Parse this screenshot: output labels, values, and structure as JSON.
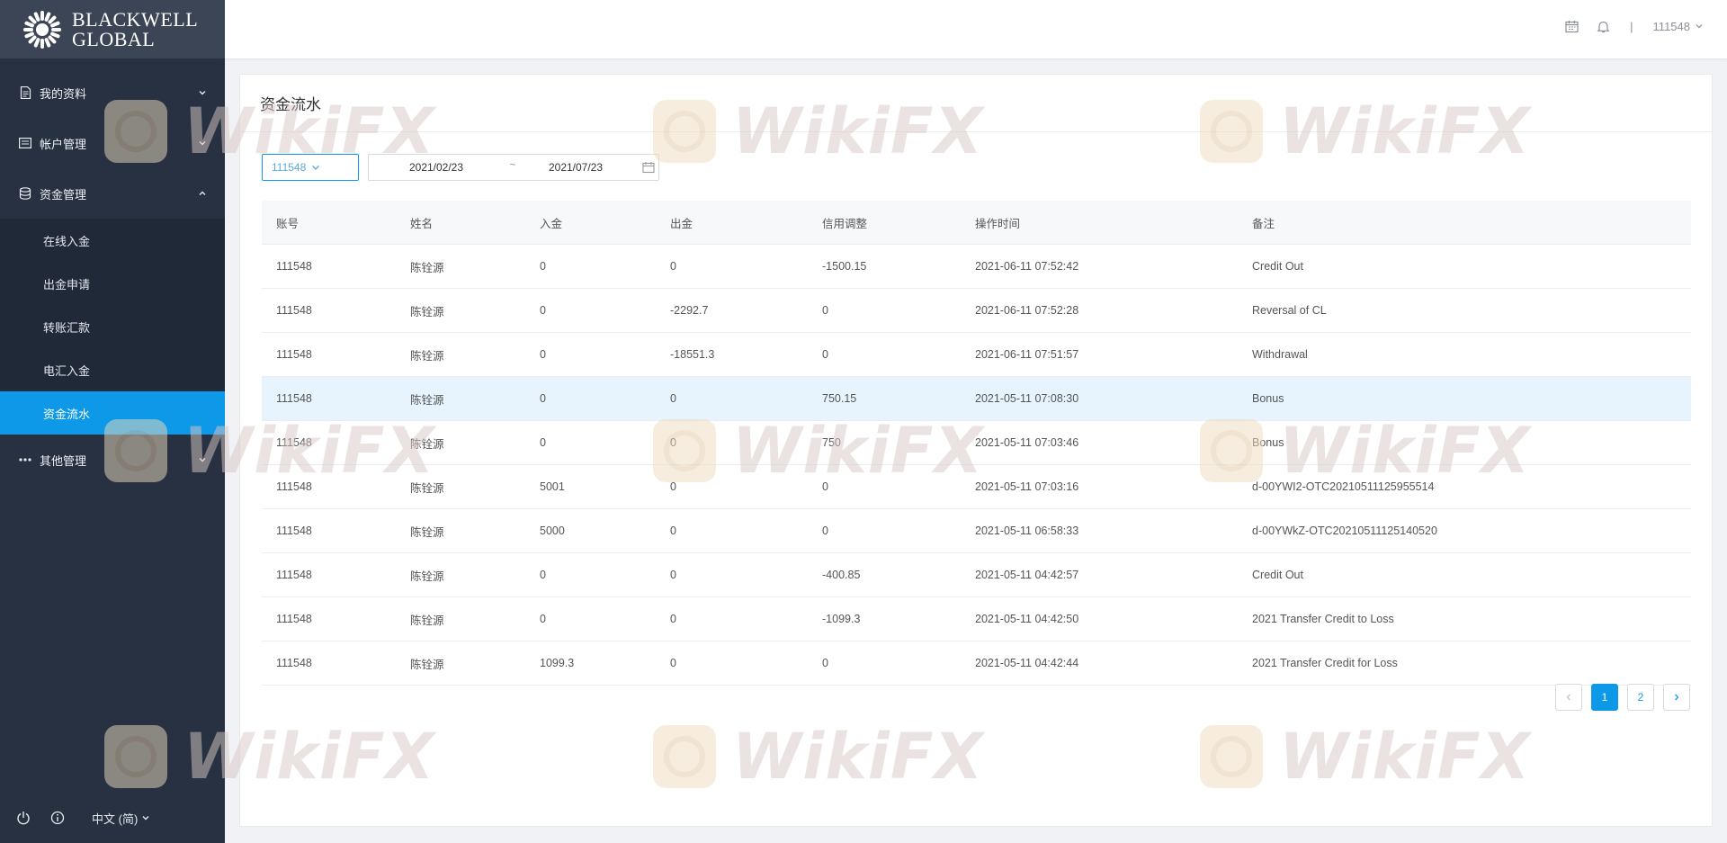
{
  "brand": {
    "line1": "BLACKWELL",
    "line2": "GLOBAL"
  },
  "sidebar": {
    "groups": [
      {
        "label": "我的资料",
        "icon": "document-icon"
      },
      {
        "label": "帐户管理",
        "icon": "card-icon"
      },
      {
        "label": "资金管理",
        "icon": "database-icon",
        "expanded": true,
        "items": [
          {
            "label": "在线入金"
          },
          {
            "label": "出金申请"
          },
          {
            "label": "转账汇款"
          },
          {
            "label": "电汇入金"
          },
          {
            "label": "资金流水",
            "active": true
          }
        ]
      },
      {
        "label": "其他管理",
        "icon": "more-icon"
      }
    ],
    "language": "中文 (简)"
  },
  "header": {
    "user": "111548",
    "separator": "|"
  },
  "page": {
    "title": "资金流水",
    "filter": {
      "account": "111548",
      "date_from": "2021/02/23",
      "date_sep": "~",
      "date_to": "2021/07/23"
    }
  },
  "table": {
    "columns": [
      "账号",
      "姓名",
      "入金",
      "出金",
      "信用调整",
      "操作时间",
      "备注"
    ],
    "rows": [
      [
        "111548",
        "陈铨源",
        "0",
        "0",
        "-1500.15",
        "2021-06-11 07:52:42",
        "Credit Out"
      ],
      [
        "111548",
        "陈铨源",
        "0",
        "-2292.7",
        "0",
        "2021-06-11 07:52:28",
        "Reversal of CL"
      ],
      [
        "111548",
        "陈铨源",
        "0",
        "-18551.3",
        "0",
        "2021-06-11 07:51:57",
        "Withdrawal"
      ],
      [
        "111548",
        "陈铨源",
        "0",
        "0",
        "750.15",
        "2021-05-11 07:08:30",
        "Bonus"
      ],
      [
        "111548",
        "陈铨源",
        "0",
        "0",
        "750",
        "2021-05-11 07:03:46",
        "Bonus"
      ],
      [
        "111548",
        "陈铨源",
        "5001",
        "0",
        "0",
        "2021-05-11 07:03:16",
        "d-00YWI2-OTC20210511125955514"
      ],
      [
        "111548",
        "陈铨源",
        "5000",
        "0",
        "0",
        "2021-05-11 06:58:33",
        "d-00YWkZ-OTC20210511125140520"
      ],
      [
        "111548",
        "陈铨源",
        "0",
        "0",
        "-400.85",
        "2021-05-11 04:42:57",
        "Credit Out"
      ],
      [
        "111548",
        "陈铨源",
        "0",
        "0",
        "-1099.3",
        "2021-05-11 04:42:50",
        "2021 Transfer Credit to Loss"
      ],
      [
        "111548",
        "陈铨源",
        "1099.3",
        "0",
        "0",
        "2021-05-11 04:42:44",
        "2021 Transfer Credit for Loss"
      ]
    ],
    "highlighted_row": 3
  },
  "pagination": {
    "pages": [
      "1",
      "2"
    ],
    "current": "1"
  },
  "watermark": {
    "text": "WikiFX"
  },
  "colors": {
    "accent": "#0e99e8",
    "sidebar": "#273142",
    "sidebar_dark": "#1f2937",
    "row_highlight": "#e8f4fd"
  }
}
